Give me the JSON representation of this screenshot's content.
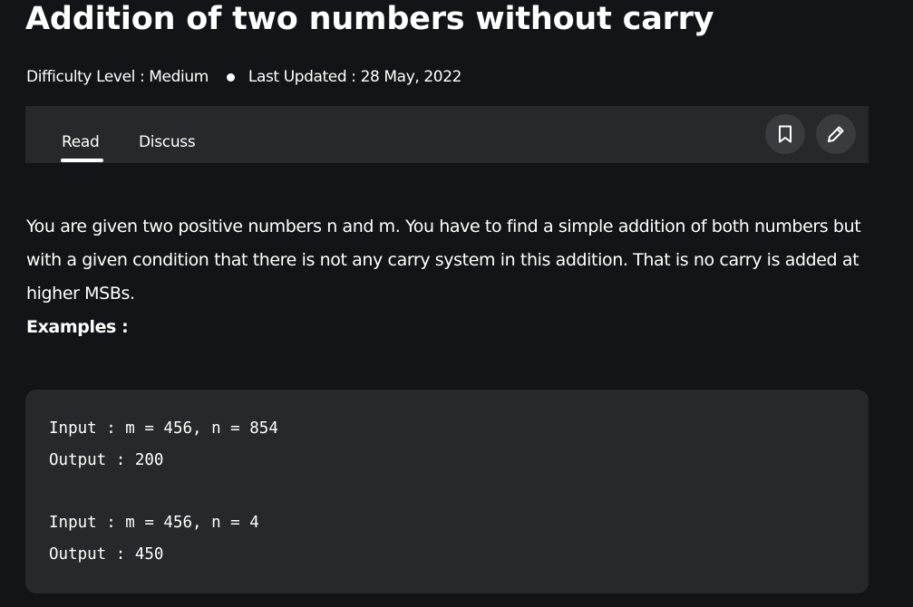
{
  "article": {
    "title": "Addition of two numbers without carry",
    "difficulty": "Difficulty Level : Medium",
    "last_updated": "Last Updated : 28 May, 2022"
  },
  "tabs": [
    {
      "label": "Read",
      "active": true
    },
    {
      "label": "Discuss",
      "active": false
    }
  ],
  "actions": {
    "bookmark_icon": "bookmark-icon",
    "edit_icon": "pencil-icon"
  },
  "content": {
    "paragraph": "You are given two positive numbers n and m. You have to find a simple addition of both numbers but with a given condition that there is not any carry system in this addition. That is no carry is added at higher MSBs.",
    "examples_label": "Examples :"
  },
  "code_examples": [
    {
      "input": "Input : m = 456, n = 854",
      "output": "Output : 200"
    },
    {
      "input": "Input : m = 456, n = 4",
      "output": "Output : 450"
    }
  ],
  "colors": {
    "background": "#131417",
    "panel": "#27282b",
    "icon_button": "#3a3b3e",
    "text": "#ffffff"
  }
}
